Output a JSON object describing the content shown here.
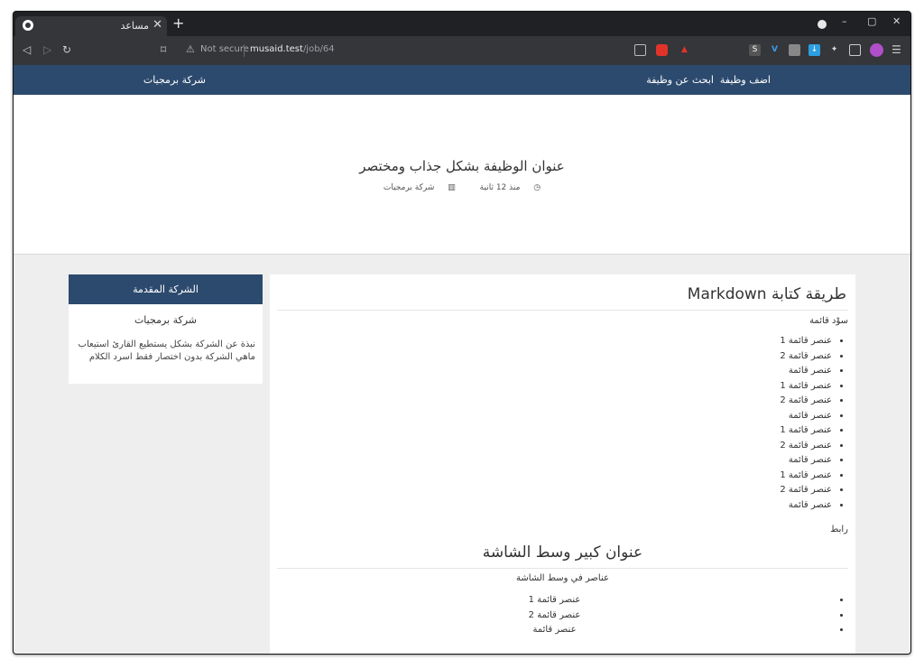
{
  "browser": {
    "tab_title": "مساعد",
    "new_tab": "+",
    "close_tab": "✕",
    "security_label": "Not secure",
    "url_host": "musaid.test",
    "url_path": "/job/64",
    "window_controls": [
      "–",
      "▢",
      "✕"
    ],
    "icons": [
      "back-icon",
      "forward-icon",
      "reload-icon",
      "bookmark-icon",
      "qr-icon",
      "brave-shield-icon",
      "brave-rewards-icon",
      "extensions-icon",
      "wallet-icon",
      "profile-icon",
      "menu-icon"
    ]
  },
  "nav": {
    "add_job": "اضف وظيفة",
    "search_job": "ابحث عن وظيفة",
    "company": "شركة برمجيات"
  },
  "hero": {
    "title": "عنوان الوظيفة بشكل جذاب ومختصر",
    "time": "منذ 12 ثانية",
    "company": "شركة برمجيات"
  },
  "main": {
    "heading": "طريقة كتابة Markdown",
    "intro": "سوْد قائمة",
    "list": [
      "عنصر قائمة 1",
      "عنصر قائمة 2",
      "عنصر قائمة",
      "عنصر قائمة 1",
      "عنصر قائمة 2",
      "عنصر قائمة",
      "عنصر قائمة 1",
      "عنصر قائمة 2",
      "عنصر قائمة",
      "عنصر قائمة 1",
      "عنصر قائمة 2",
      "عنصر قائمة"
    ],
    "link": "رابط",
    "center_heading": "عنوان كبير وسط الشاشة",
    "center_intro": "عناصر في وسط الشاشة",
    "center_list": [
      "عنصر قائمة 1",
      "عنصر قائمة 2",
      "عنصر قائمة"
    ]
  },
  "aside": {
    "header": "الشركة المقدمة",
    "name": "شركة برمجيات",
    "description": "نبذة عن الشركة بشكل يستطيع القارئ استيعاب ماهي الشركة بدون اختصار فقط اسرد الكلام"
  },
  "colors": {
    "nav_bg": "#2c4a6e",
    "page_bg": "#eeeeee",
    "browser_bg": "#35363a"
  }
}
